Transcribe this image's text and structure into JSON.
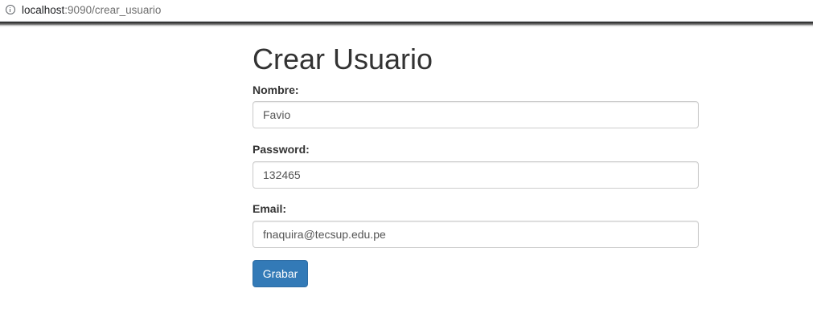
{
  "browser": {
    "url_host": "localhost",
    "url_path": ":9090/crear_usuario",
    "info_icon": "info-icon"
  },
  "form": {
    "title": "Crear Usuario",
    "nombre": {
      "label": "Nombre:",
      "value": "Favio"
    },
    "password": {
      "label": "Password:",
      "value": "132465"
    },
    "email": {
      "label": "Email:",
      "value": "fnaquira@tecsup.edu.pe"
    },
    "submit_label": "Grabar"
  },
  "colors": {
    "primary_button": "#337ab7",
    "text": "#333333",
    "input_border": "#cccccc"
  }
}
